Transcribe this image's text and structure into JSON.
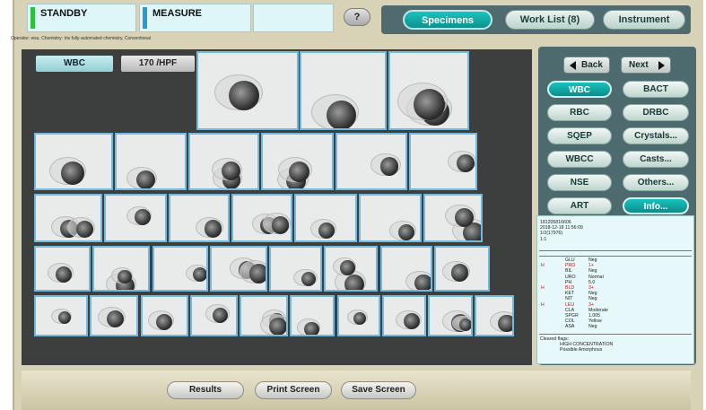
{
  "status": {
    "state_left": "STANDBY",
    "state_right": "MEASURE",
    "operator_line": "Operator: wsu.   Chemistry: Iris fully-automated chemistry, Conventional",
    "help_label": "?",
    "bar_colors": [
      "#2fbf3f",
      "#2a9ad6"
    ]
  },
  "nav": {
    "tabs": [
      {
        "label": "Specimens",
        "active": true
      },
      {
        "label": "Work List (8)",
        "active": false
      },
      {
        "label": "Instrument",
        "active": false
      }
    ]
  },
  "viewer": {
    "category": "WBC",
    "count": "170 /HPF"
  },
  "panel": {
    "back_label": "Back",
    "next_label": "Next",
    "buttons": [
      {
        "label": "WBC",
        "active": true
      },
      {
        "label": "BACT",
        "active": false
      },
      {
        "label": "RBC",
        "active": false
      },
      {
        "label": "DRBC",
        "active": false
      },
      {
        "label": "SQEP",
        "active": false
      },
      {
        "label": "Crystals...",
        "active": false
      },
      {
        "label": "WBCC",
        "active": false
      },
      {
        "label": "Casts...",
        "active": false
      },
      {
        "label": "NSE",
        "active": false
      },
      {
        "label": "Others...",
        "active": false
      },
      {
        "label": "ART",
        "active": false
      },
      {
        "label": "Info...",
        "active": true
      }
    ]
  },
  "specimen": {
    "id": "181205816606",
    "datetime": "2018-12-18 11:56:09",
    "ref": "1/2(17976)",
    "dilution": "1:1"
  },
  "chemistry": [
    {
      "flag": "",
      "test": "GLU",
      "result": "Neg"
    },
    {
      "flag": "H",
      "test": "PRO",
      "result": "1+"
    },
    {
      "flag": "",
      "test": "BIL",
      "result": "Neg"
    },
    {
      "flag": "",
      "test": "URO",
      "result": "Normal"
    },
    {
      "flag": "",
      "test": "PH",
      "result": "5.0"
    },
    {
      "flag": "H",
      "test": "BLD",
      "result": "3+"
    },
    {
      "flag": "",
      "test": "KET",
      "result": "Neg"
    },
    {
      "flag": "",
      "test": "NIT",
      "result": "Neg"
    },
    {
      "flag": "H",
      "test": "LEU",
      "result": "3+"
    },
    {
      "flag": "",
      "test": "CLA",
      "result": "Moderate"
    },
    {
      "flag": "",
      "test": "SPGR",
      "result": "1.005"
    },
    {
      "flag": "",
      "test": "COL",
      "result": "Yellow"
    },
    {
      "flag": "",
      "test": "ASA",
      "result": "Neg"
    }
  ],
  "flags": {
    "title": "Cleared flags:",
    "items": [
      "HIGH CONCENTRATION",
      "Possible Amorphous"
    ]
  },
  "bottom": {
    "buttons": [
      "Results",
      "Print Screen",
      "Save Screen"
    ]
  },
  "colors": {
    "accent": "#14aaa7",
    "panel": "#4d6a6e",
    "viewer_bg": "#3d3f3f",
    "cell_border": "#72b9df",
    "flag_red": "#d30f0f"
  }
}
